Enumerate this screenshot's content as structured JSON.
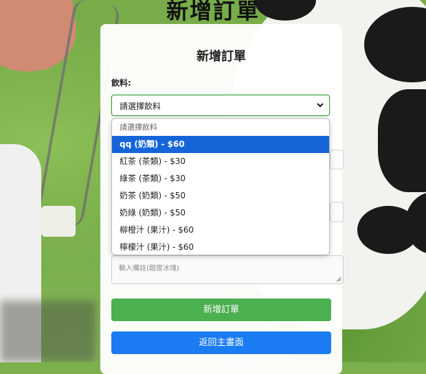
{
  "page": {
    "heading": "新增訂單"
  },
  "form": {
    "title": "新增訂單",
    "drink_label": "飲料:",
    "drink_select_value": "請選擇飲料",
    "note_placeholder": "輸入備註(甜度冰塊)",
    "submit_label": "新增訂單",
    "back_label": "返回主畫面"
  },
  "dropdown": {
    "options": [
      {
        "label": "請選擇飲料",
        "selected": false
      },
      {
        "label": "qq (奶類) - $60",
        "selected": true
      },
      {
        "label": "紅茶 (茶類) - $30",
        "selected": false
      },
      {
        "label": "綠茶 (茶類) - $30",
        "selected": false
      },
      {
        "label": "奶茶 (奶類) - $50",
        "selected": false
      },
      {
        "label": "奶綠 (奶類) - $50",
        "selected": false
      },
      {
        "label": "柳橙汁 (果汁) - $60",
        "selected": false
      },
      {
        "label": "檸檬汁 (果汁) - $60",
        "selected": false
      }
    ]
  },
  "colors": {
    "submit": "#4caf50",
    "back": "#1a7bf2",
    "selected_option": "#1565d8"
  }
}
